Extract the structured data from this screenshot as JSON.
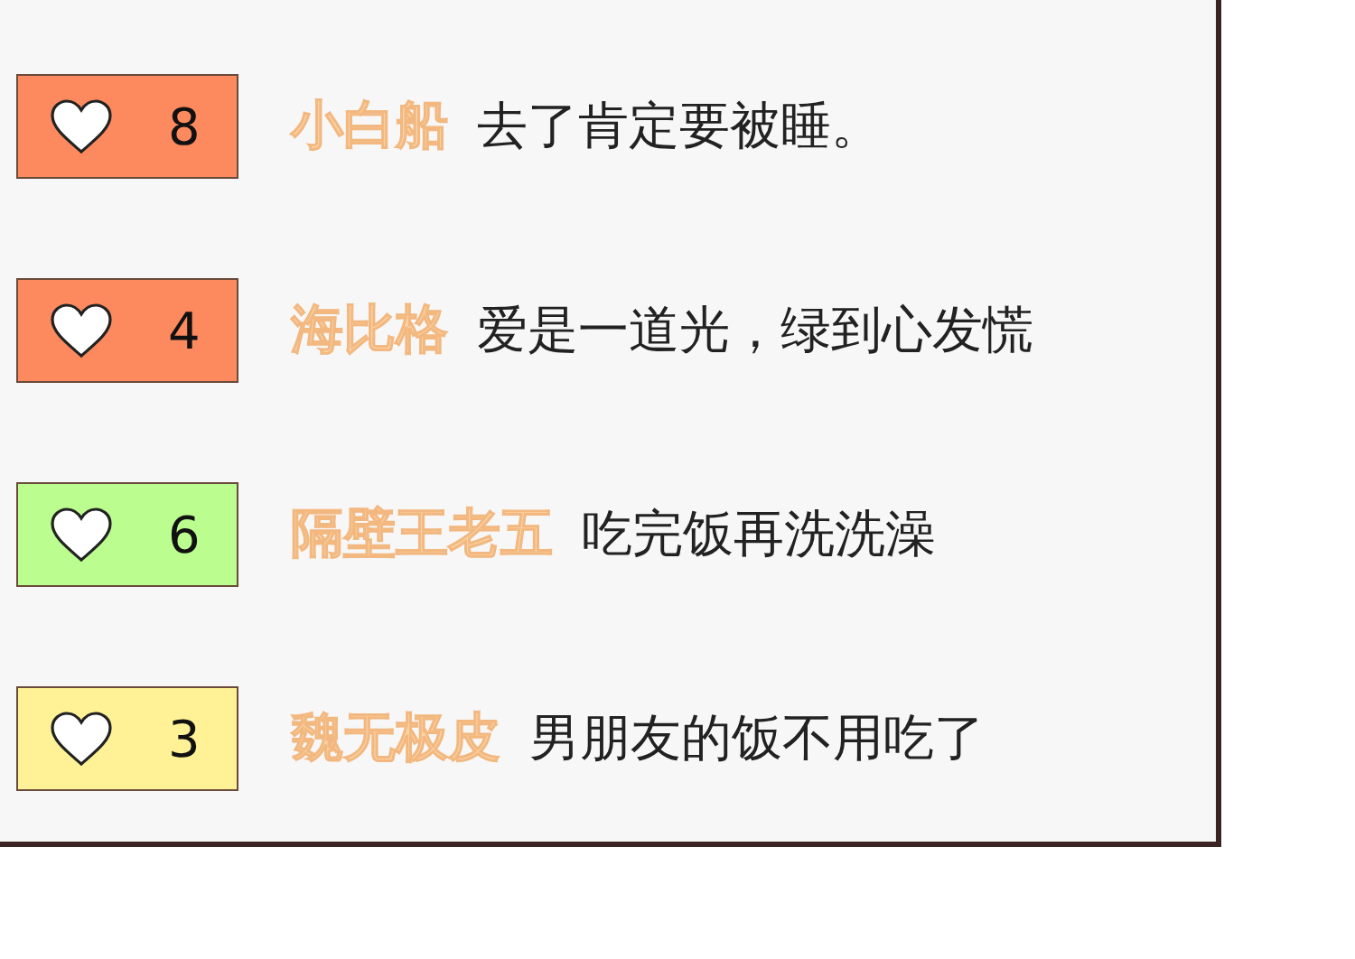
{
  "comments": [
    {
      "likes": "8",
      "color": "#fd8a5e",
      "user": "小白船",
      "text": "去了肯定要被睡。"
    },
    {
      "likes": "4",
      "color": "#fd8a5e",
      "user": "海比格",
      "text": "爱是一道光，绿到心发慌"
    },
    {
      "likes": "6",
      "color": "#bcfd8f",
      "user": "隔壁王老五",
      "text": "吃完饭再洗洗澡"
    },
    {
      "likes": "3",
      "color": "#fff196",
      "user": "魏无极皮",
      "text": "男朋友的饭不用吃了"
    }
  ]
}
